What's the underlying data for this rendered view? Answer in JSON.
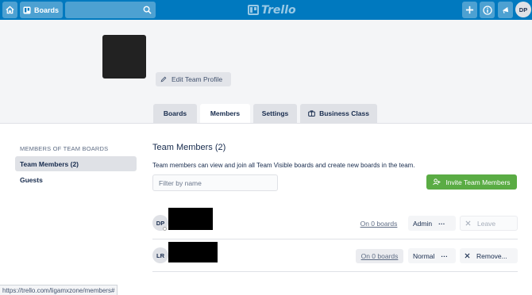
{
  "header": {
    "boards_label": "Boards",
    "search": {
      "placeholder": ""
    },
    "logo_text": "Trello",
    "user_initials": "DP"
  },
  "team": {
    "edit_profile_label": "Edit Team Profile",
    "tabs": [
      {
        "label": "Boards",
        "active": false
      },
      {
        "label": "Members",
        "active": true
      },
      {
        "label": "Settings",
        "active": false
      },
      {
        "label": "Business Class",
        "active": false
      }
    ]
  },
  "sidebar": {
    "heading": "MEMBERS OF TEAM BOARDS",
    "items": [
      {
        "label": "Team Members (2)",
        "active": true
      },
      {
        "label": "Guests",
        "active": false
      }
    ]
  },
  "main": {
    "title": "Team Members (2)",
    "description": "Team members can view and join all Team Visible boards and create new boards in the team.",
    "filter_placeholder": "Filter by name",
    "invite_label": "Invite Team Members",
    "members": [
      {
        "initials": "DP",
        "boards": "On 0 boards",
        "role": "Admin",
        "action": "Leave"
      },
      {
        "initials": "LR",
        "boards": "On 0 boards",
        "role": "Normal",
        "action": "Remove..."
      }
    ]
  },
  "status_bar": {
    "url": "https://trello.com/ligamxzone/members#"
  },
  "colors": {
    "header": "#0079bf",
    "invite_button": "#5aac44"
  }
}
